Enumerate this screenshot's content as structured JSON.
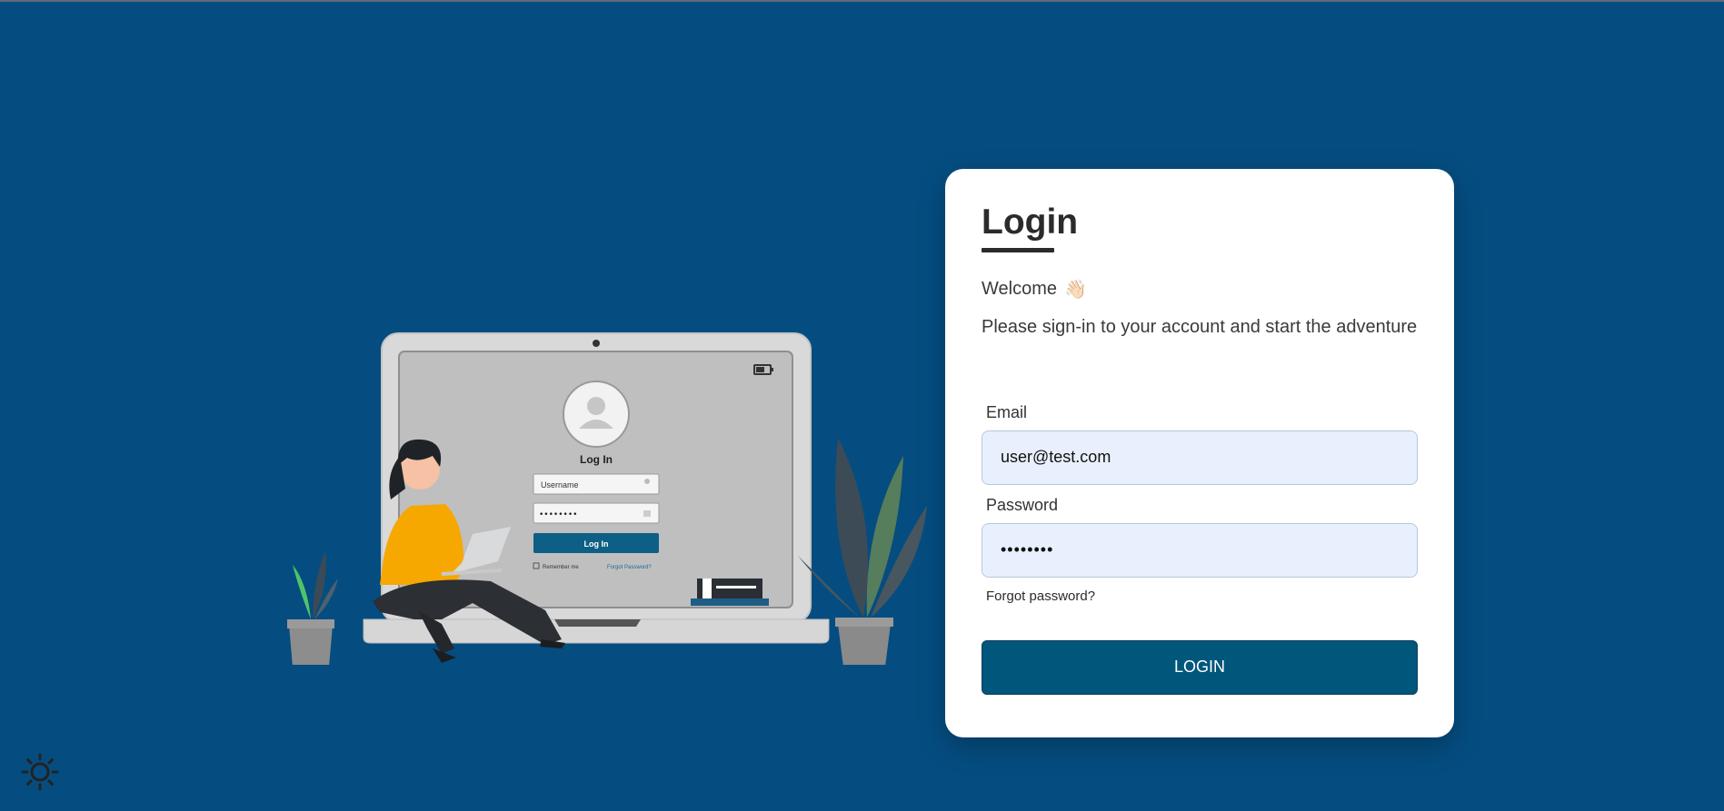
{
  "illustration": {
    "screen_title": "Log In",
    "username_placeholder": "Username",
    "password_dots": "••••••••",
    "login_button": "Log In",
    "remember_me": "Remember me",
    "forgot_password": "Forgot Password?"
  },
  "login": {
    "title": "Login",
    "welcome": "Welcome",
    "welcome_icon": "waving-hand-icon",
    "subtitle": "Please sign-in to your account and start the adventure",
    "email_label": "Email",
    "email_value": "user@test.com",
    "password_label": "Password",
    "password_value": "••••••••",
    "forgot_password": "Forgot password?",
    "button_label": "LOGIN"
  },
  "theme_toggle_icon": "sun-icon",
  "colors": {
    "background": "#054d80",
    "card": "#ffffff",
    "input_bg": "#e8f0fd",
    "button": "#00567b",
    "accent_yellow": "#f6a800"
  }
}
